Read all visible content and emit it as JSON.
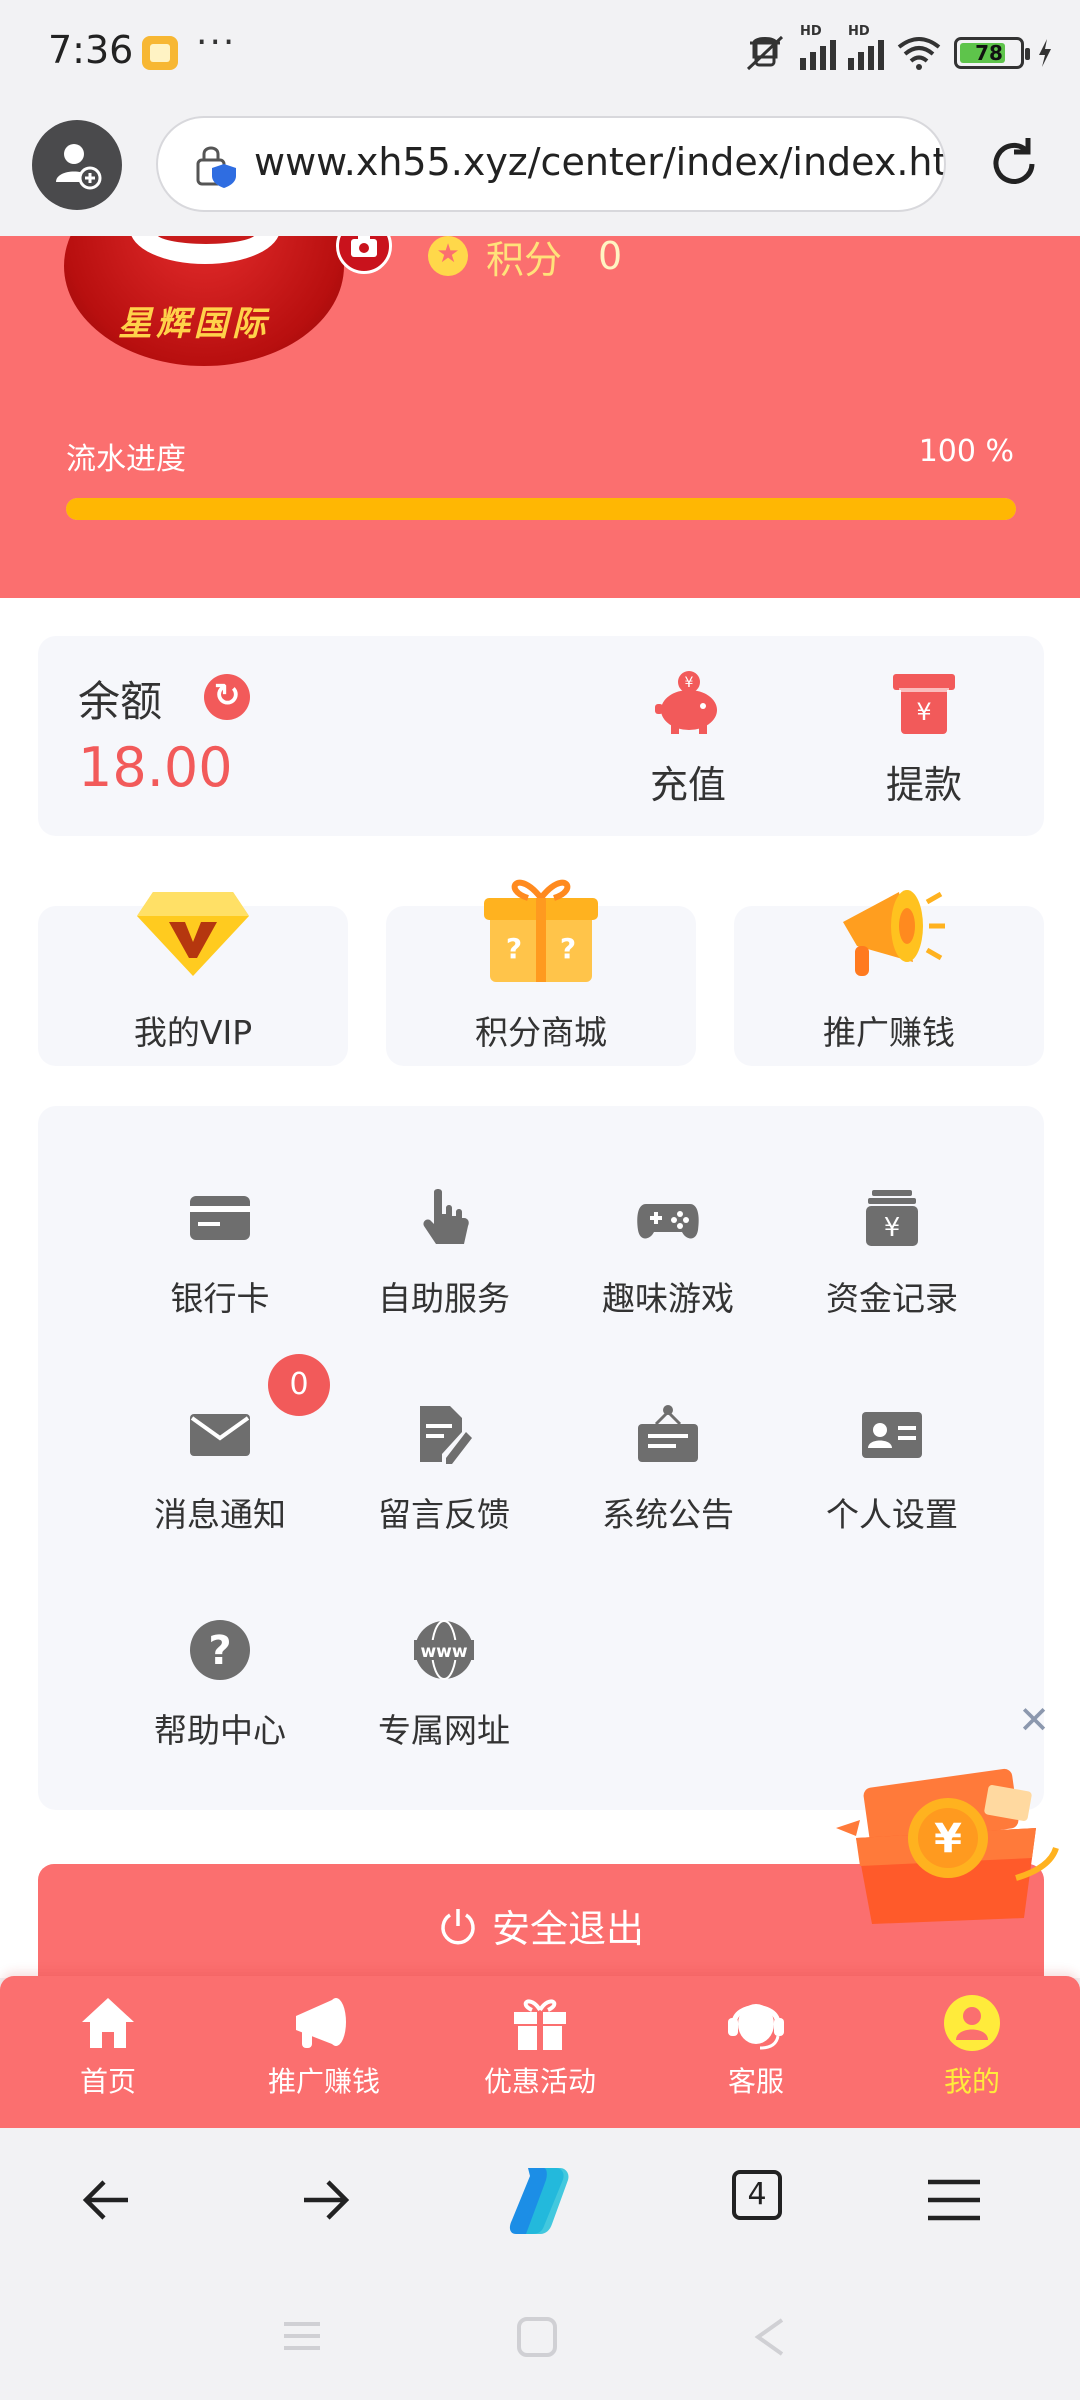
{
  "status": {
    "time": "7:36",
    "more": "···",
    "battery": "78"
  },
  "browser": {
    "url": "www.xh55.xyz/center/index/index.html",
    "open_tabs": "4"
  },
  "header": {
    "logo_text": "星辉国际",
    "points_label": "积分",
    "points_value": "0",
    "progress_label": "流水进度",
    "progress_value": "100 %",
    "progress_fraction": 1.0
  },
  "balance": {
    "label": "余额",
    "value": "18.00",
    "recharge_label": "充值",
    "withdraw_label": "提款"
  },
  "quick": [
    {
      "label": "我的VIP",
      "icon": "vip-diamond-icon"
    },
    {
      "label": "积分商城",
      "icon": "gift-box-icon"
    },
    {
      "label": "推广赚钱",
      "icon": "megaphone-icon"
    }
  ],
  "grid": [
    {
      "label": "银行卡",
      "icon": "bank-card-icon"
    },
    {
      "label": "自助服务",
      "icon": "hand-pointer-icon"
    },
    {
      "label": "趣味游戏",
      "icon": "gamepad-icon"
    },
    {
      "label": "资金记录",
      "icon": "money-record-icon"
    },
    {
      "label": "消息通知",
      "icon": "envelope-icon",
      "badge": "0"
    },
    {
      "label": "留言反馈",
      "icon": "feedback-icon"
    },
    {
      "label": "系统公告",
      "icon": "notice-board-icon"
    },
    {
      "label": "个人设置",
      "icon": "id-card-icon"
    },
    {
      "label": "帮助中心",
      "icon": "question-icon"
    },
    {
      "label": "专属网址",
      "icon": "globe-www-icon"
    }
  ],
  "logout_label": "安全退出",
  "tabbar": [
    {
      "label": "首页",
      "icon": "home-icon"
    },
    {
      "label": "推广赚钱",
      "icon": "megaphone-icon"
    },
    {
      "label": "优惠活动",
      "icon": "gift-icon"
    },
    {
      "label": "客服",
      "icon": "headset-icon"
    },
    {
      "label": "我的",
      "icon": "user-icon",
      "active": true
    }
  ],
  "colors": {
    "brand": "#fb6f6f",
    "accent": "#f25a5a",
    "progress": "#ffb703",
    "active_tab": "#ffeb3b",
    "icon_gray": "#6e6e6e"
  }
}
